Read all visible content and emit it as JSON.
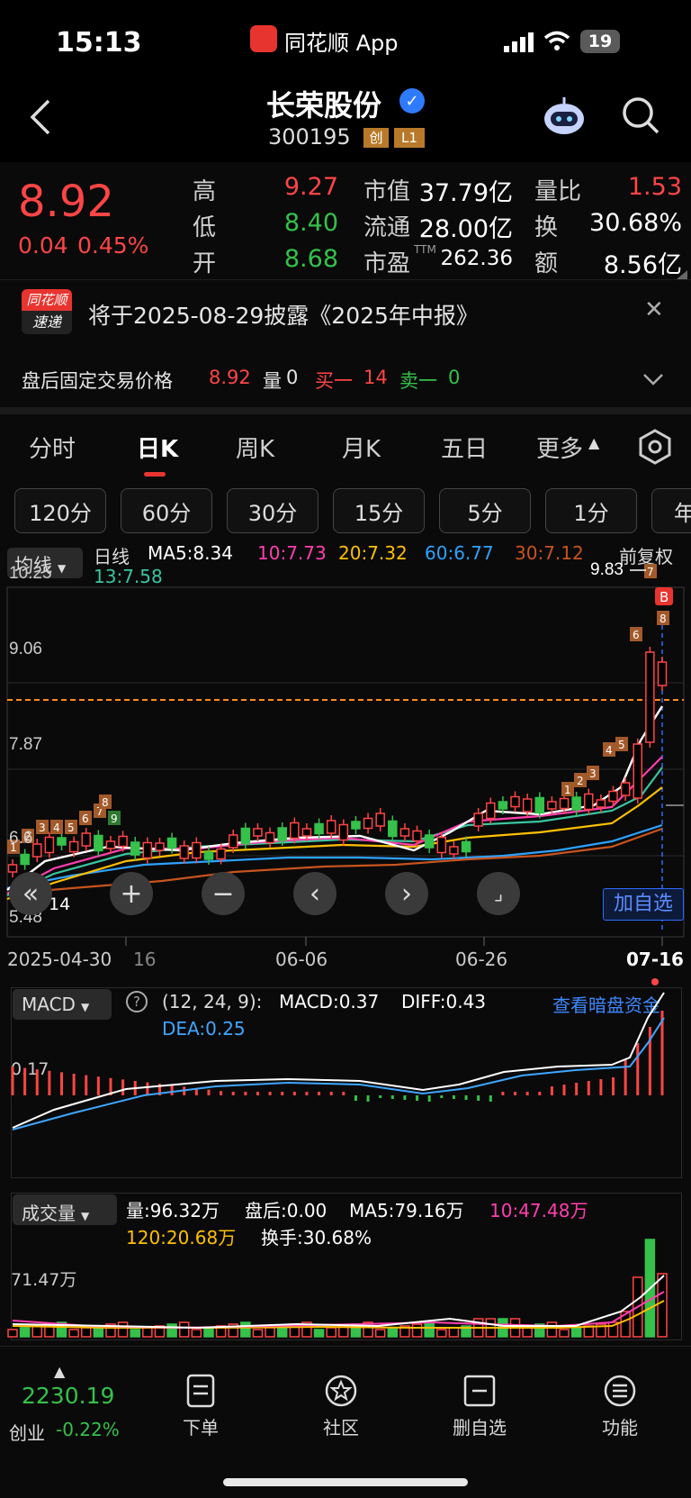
{
  "status": {
    "time": "15:13",
    "app_name": "同花顺 App",
    "battery": "19"
  },
  "header": {
    "title": "长荣股份",
    "code": "300195",
    "tag1": "创",
    "tag2": "L1"
  },
  "quote": {
    "price": "8.92",
    "change": "0.04",
    "change_pct": "0.45%",
    "high_label": "高",
    "high": "9.27",
    "low_label": "低",
    "low": "8.40",
    "open_label": "开",
    "open": "8.68",
    "mktcap_label": "市值",
    "mktcap": "37.79亿",
    "float_label": "流通",
    "float": "28.00亿",
    "pe_label": "市盈",
    "pe_sup": "TTM",
    "pe": "262.36",
    "vr_label": "量比",
    "vr": "1.53",
    "turn_label": "换",
    "turn": "30.68%",
    "amt_label": "额",
    "amt": "8.56亿"
  },
  "notice": {
    "badge_top": "同花顺",
    "badge_bottom": "速递",
    "text": "将于2025-08-29披露《2025年中报》"
  },
  "afterhours": {
    "label": "盘后固定交易价格",
    "price": "8.92",
    "vol_label": "量",
    "vol": "0",
    "buy_label": "买一",
    "buy": "14",
    "sell_label": "卖一",
    "sell": "0"
  },
  "tabs": [
    "分时",
    "日K",
    "周K",
    "月K",
    "五日",
    "更多"
  ],
  "subtabs": [
    "120分",
    "60分",
    "30分",
    "15分",
    "5分",
    "1分",
    "年"
  ],
  "kline": {
    "indicator": "均线",
    "period": "日线",
    "ma5": "MA5:8.34",
    "ma10": "10:7.73",
    "ma20": "20:7.32",
    "ma60": "60:6.77",
    "ma30": "30:7.12",
    "ma13": "13:7.58",
    "adjust": "前复权",
    "y_labels": [
      "10.25",
      "9.06",
      "7.87",
      "6.6",
      "5.48"
    ],
    "max_label": "9.83",
    "low_label": "14",
    "dates": [
      "2025-04-30",
      "16",
      "06-06",
      "06-26",
      "07-16"
    ],
    "add_watch": "加自选",
    "markers": [
      "1",
      "2",
      "3",
      "4",
      "5",
      "6",
      "7",
      "8",
      "9"
    ],
    "b_marker": "B",
    "colors": {
      "ma5": "#ffffff",
      "ma10": "#ff3fb0",
      "ma20": "#ffc000",
      "ma60": "#2ea2ff",
      "ma30": "#c8541e",
      "ma13": "#38c6a0"
    }
  },
  "macd": {
    "name": "MACD",
    "params": "(12, 24, 9):",
    "macd": "MACD:0.37",
    "diff": "DIFF:0.43",
    "dea": "DEA:0.25",
    "link": "查看暗盘资金",
    "axis": "0.17"
  },
  "volume": {
    "name": "成交量",
    "vol": "量:96.32万",
    "after": "盘后:0.00",
    "ma5": "MA5:79.16万",
    "ma10": "10:47.48万",
    "ma120": "120:20.68万",
    "turnover": "换手:30.68%",
    "axis": "71.47万"
  },
  "bottom": {
    "index_value": "2230.19",
    "index_name": "创业",
    "index_change": "-0.22%",
    "items": [
      "下单",
      "社区",
      "删自选",
      "功能"
    ]
  },
  "chart_data": {
    "type": "candlestick",
    "x": [
      "2025-04-30",
      "06-06",
      "06-26",
      "07-16"
    ],
    "ylim": [
      5.48,
      10.25
    ],
    "last_close": 8.92,
    "high": 9.27,
    "low": 8.4,
    "open": 8.68,
    "max_marker": 9.83,
    "series": [
      {
        "name": "MA5",
        "values": [
          8.34
        ]
      },
      {
        "name": "MA10",
        "values": [
          7.73
        ]
      },
      {
        "name": "MA20",
        "values": [
          7.32
        ]
      },
      {
        "name": "MA30",
        "values": [
          7.12
        ]
      },
      {
        "name": "MA60",
        "values": [
          6.77
        ]
      },
      {
        "name": "MA13",
        "values": [
          7.58
        ]
      }
    ]
  }
}
